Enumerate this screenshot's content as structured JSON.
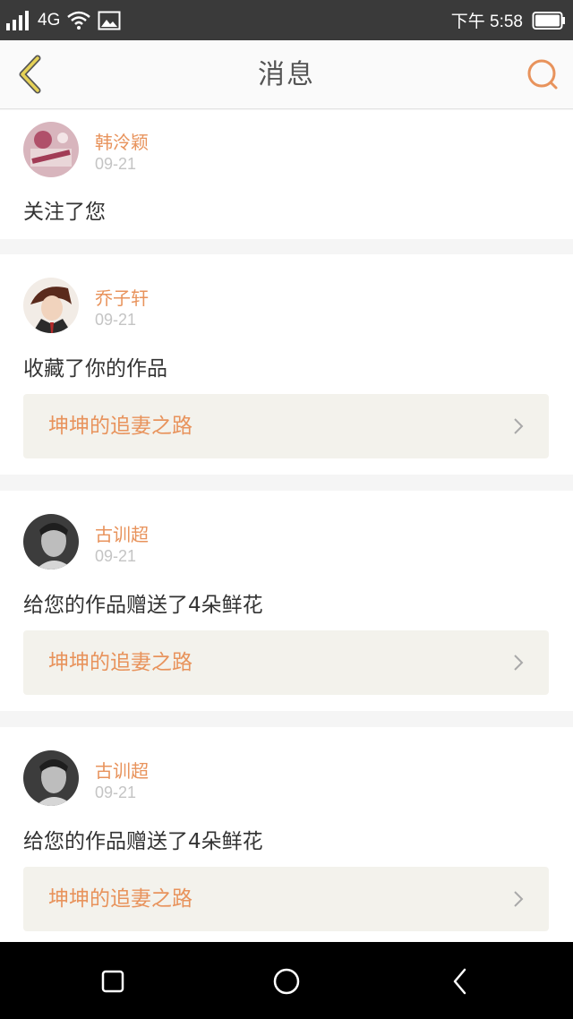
{
  "status_bar": {
    "signal_icon": "signal-bars-icon",
    "network": "4G",
    "wifi_icon": "wifi-icon",
    "image_icon": "image-icon",
    "time": "下午 5:58",
    "battery_icon": "battery-icon"
  },
  "header": {
    "back_icon": "chevron-left-icon",
    "title": "消息",
    "search_icon": "search-icon",
    "accent": "#e8935c",
    "back_color": "#d9c24a"
  },
  "messages": [
    {
      "user": "韩泠颖",
      "date": "09-21",
      "text": "关注了您"
    },
    {
      "user": "乔子轩",
      "date": "09-21",
      "text": "收藏了你的作品",
      "work": "坤坤的追妻之路"
    },
    {
      "user": "古训超",
      "date": "09-21",
      "text": "给您的作品赠送了4朵鲜花",
      "work": "坤坤的追妻之路"
    },
    {
      "user": "古训超",
      "date": "09-21",
      "text": "给您的作品赠送了4朵鲜花",
      "work": "坤坤的追妻之路"
    }
  ],
  "nav_bar": {
    "recent_icon": "square-icon",
    "home_icon": "circle-icon",
    "back_icon": "triangle-back-icon"
  }
}
